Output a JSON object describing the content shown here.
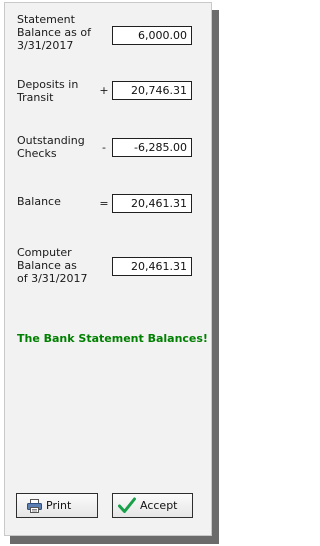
{
  "colors": {
    "status": "#008000",
    "accept_check": "#18a04a"
  },
  "reconciliation": {
    "statement": {
      "label": "Statement\nBalance as of\n3/31/2017",
      "operator": "",
      "value": "6,000.00"
    },
    "deposits": {
      "label": "Deposits in\nTransit",
      "operator": "+",
      "value": "20,746.31"
    },
    "outstanding": {
      "label": "Outstanding\nChecks",
      "operator": "-",
      "value": "-6,285.00"
    },
    "balance": {
      "label": "Balance",
      "operator": "=",
      "value": "20,461.31"
    },
    "computer": {
      "label": "Computer\nBalance as\nof 3/31/2017",
      "operator": "",
      "value": "20,461.31"
    }
  },
  "status_message": "The Bank Statement Balances!",
  "buttons": {
    "print_label": "Print",
    "print_icon": "printer-icon",
    "accept_label": "Accept",
    "accept_icon": "checkmark-icon"
  }
}
